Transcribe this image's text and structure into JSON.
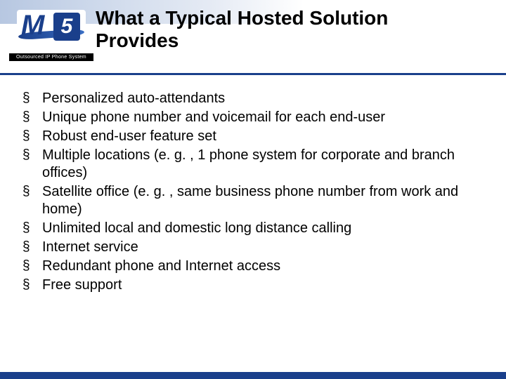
{
  "logo": {
    "letter_m": "M",
    "number_5": "5",
    "tagline": "Outsourced IP Phone System"
  },
  "title": "What a Typical Hosted Solution Provides",
  "bullets": [
    "Personalized auto-attendants",
    "Unique phone number and voicemail for each end-user",
    "Robust end-user feature set",
    "Multiple locations (e. g. , 1 phone system for corporate and branch offices)",
    "Satellite office (e. g. , same business phone number from work and home)",
    "Unlimited local and domestic long distance calling",
    "Internet service",
    "Redundant phone and Internet access",
    "Free support"
  ]
}
